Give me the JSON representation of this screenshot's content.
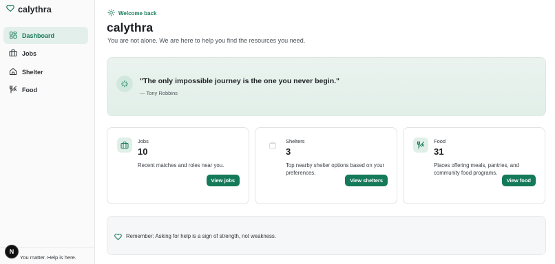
{
  "app": {
    "name": "calythra"
  },
  "sidebar": {
    "items": [
      {
        "label": "Dashboard",
        "icon": "dashboard-icon",
        "active": true
      },
      {
        "label": "Jobs",
        "icon": "briefcase-icon",
        "active": false
      },
      {
        "label": "Shelter",
        "icon": "home-icon",
        "active": false
      },
      {
        "label": "Food",
        "icon": "utensils-icon",
        "active": false
      }
    ],
    "footer_text": "You matter. Help is here.",
    "badge_letter": "N"
  },
  "header": {
    "welcome": "Welcome back",
    "title": "calythra",
    "subtitle": "You are not alone. We are here to help you find the resources you need."
  },
  "quote": {
    "text": "\"The only impossible journey is the one you never begin.\"",
    "author": "— Tony Robbins"
  },
  "cards": [
    {
      "label": "Jobs",
      "count": "10",
      "description": "Recent matches and roles near you.",
      "button": "View jobs",
      "icon": "briefcase-icon"
    },
    {
      "label": "Shelters",
      "count": "3",
      "description": "Top nearby shelter options based on your preferences.",
      "button": "View shelters",
      "icon": "shelter-icon"
    },
    {
      "label": "Food",
      "count": "31",
      "description": "Places offering meals, pantries, and community food programs.",
      "button": "View food",
      "icon": "utensils-icon"
    }
  ],
  "reminder": {
    "text": "Remember: Asking for help is a sign of strength, not weakness."
  },
  "colors": {
    "accent": "#147a5a",
    "accent_light": "#e3efea",
    "sidebar_bg": "#fafafa"
  }
}
